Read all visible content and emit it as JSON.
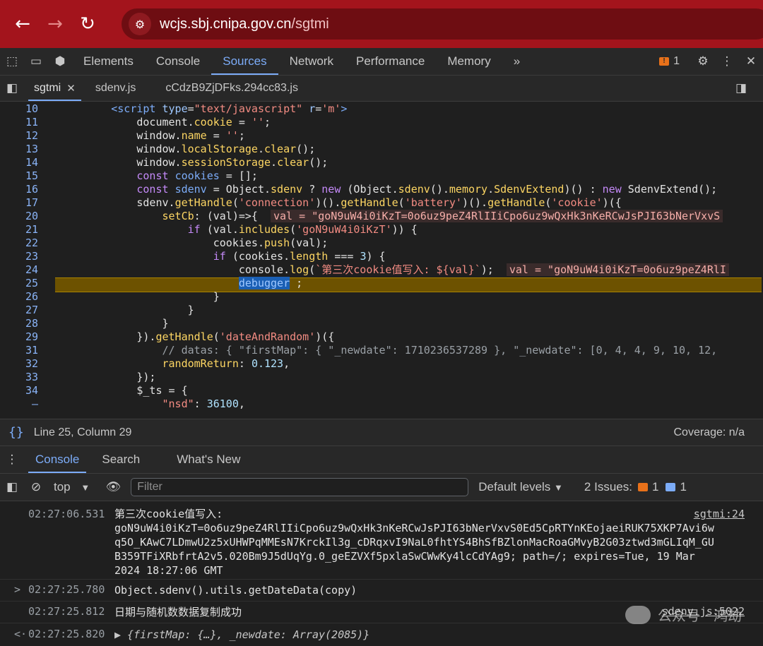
{
  "browser": {
    "url_host": "wcjs.sbj.cnipa.gov.cn",
    "url_path": "/sgtmi"
  },
  "devtools": {
    "tabs": [
      "Elements",
      "Console",
      "Sources",
      "Network",
      "Performance",
      "Memory"
    ],
    "more": "»",
    "issues_count": "1"
  },
  "files": {
    "tabs": [
      "sgtmi",
      "sdenv.js",
      "cCdzB9ZjDFks.294cc83.js"
    ]
  },
  "editor": {
    "line_numbers": [
      "10",
      "11",
      "12",
      "13",
      "14",
      "15",
      "16",
      "17",
      "20",
      "21",
      "22",
      "23",
      "24",
      "25",
      "26",
      "27",
      "28",
      "29",
      "31",
      "32",
      "33",
      "34",
      "–"
    ]
  },
  "status": {
    "position": "Line 25, Column 29",
    "coverage": "Coverage: n/a"
  },
  "drawer": {
    "tabs": [
      "Console",
      "Search",
      "What's New"
    ]
  },
  "console_toolbar": {
    "context": "top",
    "filter_placeholder": "Filter",
    "levels": "Default levels",
    "issues_label": "2 Issues:",
    "issues_orange": "1",
    "issues_blue": "1"
  },
  "console": {
    "messages": [
      {
        "time": "02:27:06.531",
        "text": "第三次cookie值写入:\ngoN9uW4i0iKzT=0o6uz9peZ4RlIIiCpo6uz9wQxHk3nKeRCwJsPJI63bNerVxvS0Ed5CpRTYnKEojaeiRUK75XKP7Avi6w\nq5O_KAwC7LDmwU2z5xUHWPqMMEsN7KrckIl3g_cDRqxvI9NaL0fhtYS4BhSfBZlonMacRoaGMvyB2G03ztwd3mGLIqM_GU\nB359TFiXRbfrtA2v5.020Bm9J5dUqYg.0_geEZVXf5pxlaSwCWwKy4lcCdYAg9; path=/; expires=Tue, 19 Mar\n2024 18:27:06 GMT",
        "source": "sgtmi:24"
      },
      {
        "time": "02:27:25.780",
        "text": "Object.sdenv().utils.getDateData(copy)",
        "prefix": ">"
      },
      {
        "time": "02:27:25.812",
        "text": "日期与随机数数据复制成功",
        "source": "sdenv.js:5022"
      },
      {
        "time": "02:27:25.820",
        "text": "▶ {firstMap: {…}, _newdate: Array(2085)}",
        "prefix": "<·"
      }
    ]
  },
  "watermark": "公众号 · 鸿劫"
}
